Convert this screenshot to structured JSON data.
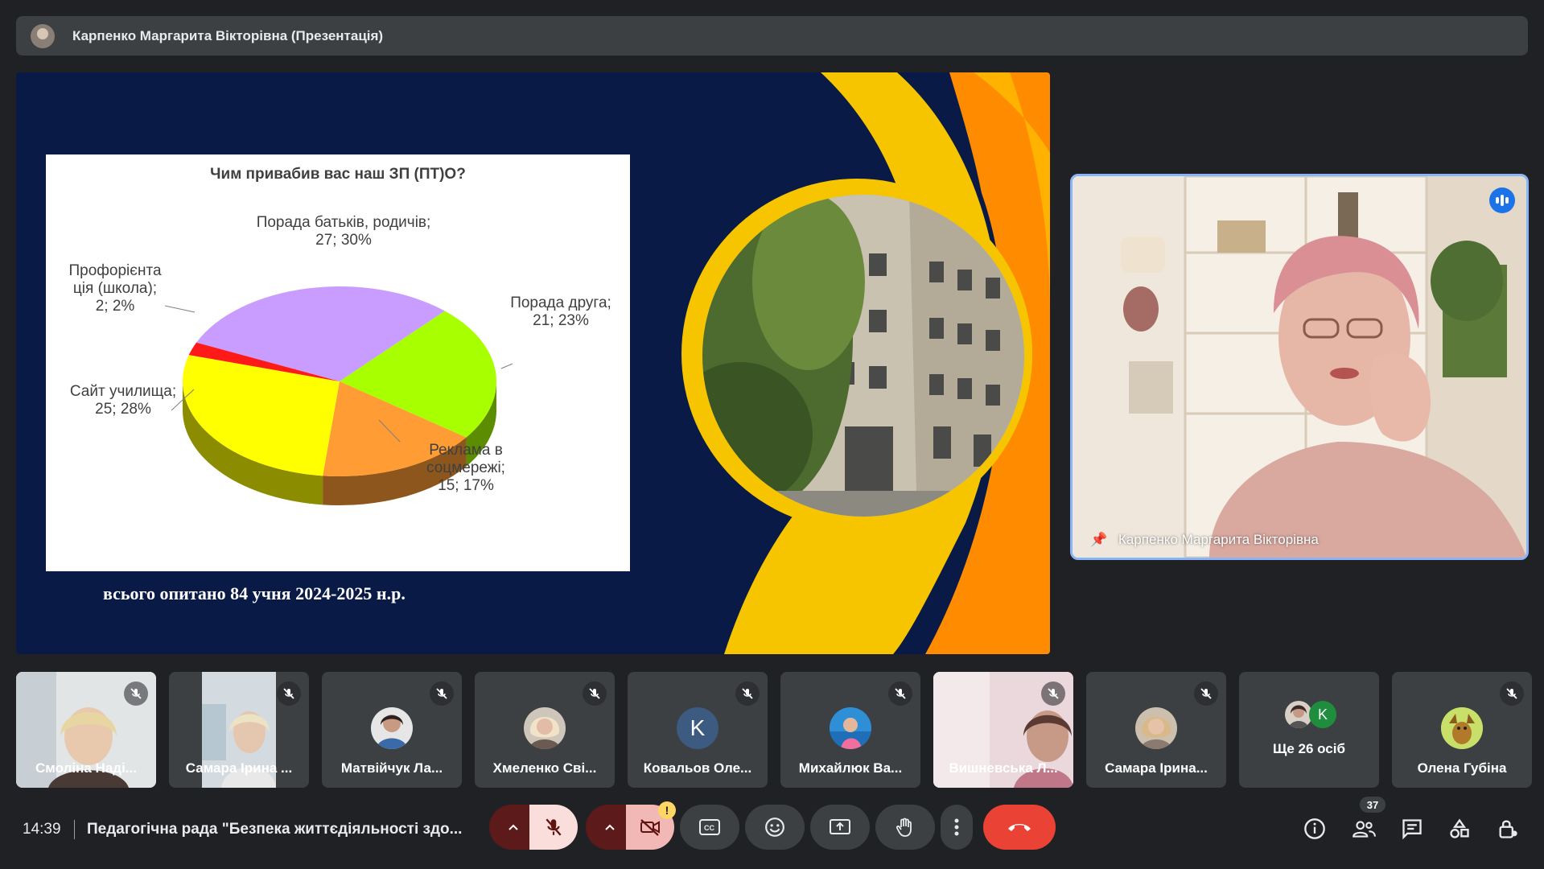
{
  "header": {
    "presenter_title": "Карпенко Маргарита Вікторівна (Презентація)"
  },
  "slide": {
    "caption": "всього опитано 84 учня 2024-2025 н.р."
  },
  "chart_data": {
    "type": "pie",
    "title": "Чим привабив вас наш ЗП (ПТ)О?",
    "slices": [
      {
        "label_lines": [
          "Порада батьків, родичів;",
          "27; 30%"
        ],
        "value": 27,
        "percent": 30,
        "color": "#c99cff"
      },
      {
        "label_lines": [
          "Порада друга;",
          "21; 23%"
        ],
        "value": 21,
        "percent": 23,
        "color": "#a8ff00"
      },
      {
        "label_lines": [
          "Реклама в",
          "соцмережі;",
          "15; 17%"
        ],
        "value": 15,
        "percent": 17,
        "color": "#ff9c33"
      },
      {
        "label_lines": [
          "Сайт училища;",
          "25; 28%"
        ],
        "value": 25,
        "percent": 28,
        "color": "#ffff00"
      },
      {
        "label_lines": [
          "Профорієнта",
          "ція (школа);",
          "2; 2%"
        ],
        "value": 2,
        "percent": 2,
        "color": "#ff1a1a"
      }
    ]
  },
  "speaker": {
    "name": "Карпенко Маргарита Вікторівна"
  },
  "participants": [
    {
      "name": "Смоліна Наді...",
      "kind": "video",
      "muted": true
    },
    {
      "name": "Самара Ірина ...",
      "kind": "video",
      "muted": true
    },
    {
      "name": "Матвійчук Ла...",
      "kind": "avatar",
      "muted": true,
      "avatar_color": "#5f6b8a"
    },
    {
      "name": "Хмеленко Сві...",
      "kind": "avatar",
      "muted": true,
      "avatar_color": "#b7a58e"
    },
    {
      "name": "Ковальов Оле...",
      "kind": "letter",
      "letter": "K",
      "muted": true,
      "avatar_color": "#3d5a80"
    },
    {
      "name": "Михайлюк Ва...",
      "kind": "avatar",
      "muted": true,
      "avatar_color": "#2f8fd6"
    },
    {
      "name": "Вишневська Л...",
      "kind": "video",
      "muted": true
    },
    {
      "name": "Самара Ірина...",
      "kind": "avatar",
      "muted": true,
      "avatar_color": "#c9b29a"
    },
    {
      "name": "Ще 26 осіб",
      "kind": "more",
      "muted": false,
      "letter": "K"
    },
    {
      "name": "Олена Губіна",
      "kind": "avatar",
      "muted": true,
      "avatar_color": "#7aa32b"
    }
  ],
  "bottom_bar": {
    "time": "14:39",
    "meeting_title": "Педагогічна рада \"Безпека життєдіяльності здо...",
    "people_count": "37",
    "camera_warning": "!"
  },
  "colors": {
    "accent_blue": "#8ab4f8",
    "end_call": "#ea4335",
    "bar_bg": "#3c4043"
  }
}
